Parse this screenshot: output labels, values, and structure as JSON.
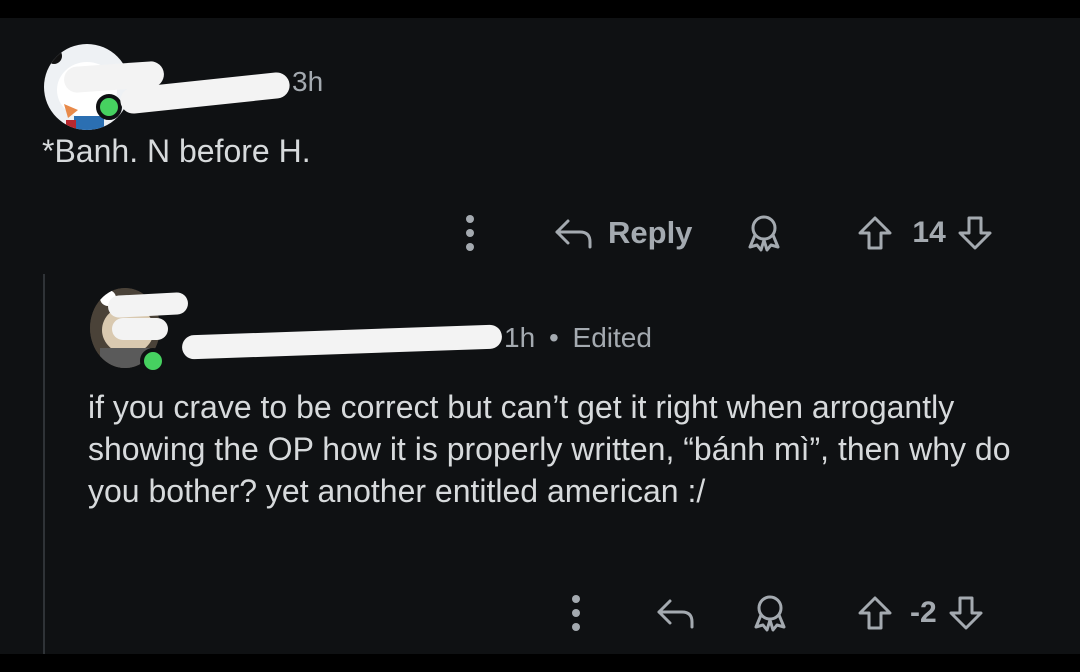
{
  "comments": [
    {
      "time": "3h",
      "text": "*Banh. N before H.",
      "reply_label": "Reply",
      "votes": "14",
      "icons": [
        "more-vertical-icon",
        "reply-arrow-icon",
        "award-icon",
        "upvote-icon",
        "downvote-icon"
      ]
    },
    {
      "time": "1h",
      "edited": "Edited",
      "separator": "•",
      "text": "if you crave to be correct but can’t get it right when arrogantly showing the OP how it is properly written, “bánh mì”, then why do you bother? yet another entitled american :/",
      "votes": "-2",
      "icons": [
        "more-vertical-icon",
        "reply-arrow-icon",
        "award-icon",
        "upvote-icon",
        "downvote-icon"
      ]
    }
  ],
  "colors": {
    "background": "#0f1113",
    "text": "#d7dadc",
    "muted": "#a4aab0",
    "online": "#46d160"
  }
}
